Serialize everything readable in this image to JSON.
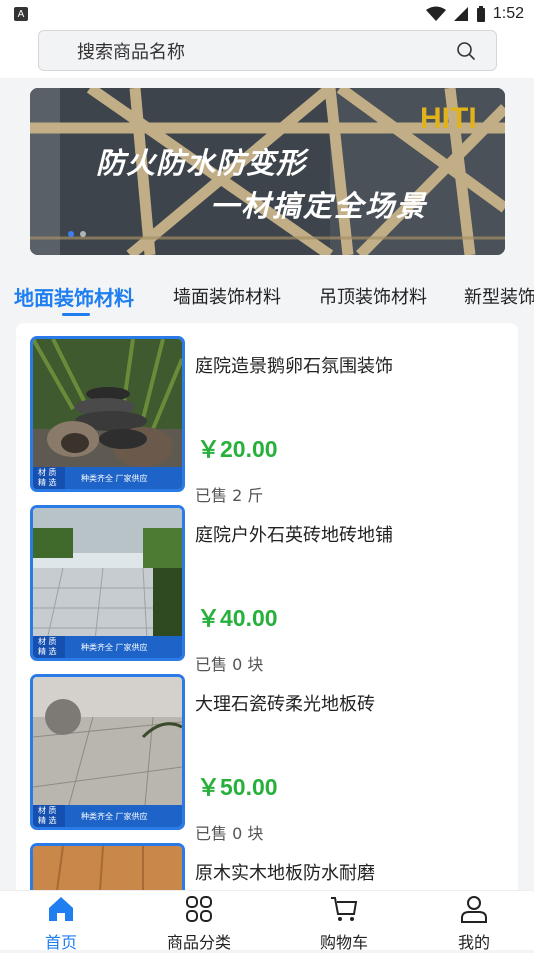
{
  "status": {
    "left_icon": "A",
    "time": "1:52"
  },
  "search": {
    "placeholder": "搜索商品名称"
  },
  "banner": {
    "line1": "防火防水防变形",
    "line2": "一材搞定全场景"
  },
  "tabs": [
    {
      "label": "地面装饰材料",
      "active": true
    },
    {
      "label": "墙面装饰材料",
      "active": false
    },
    {
      "label": "吊顶装饰材料",
      "active": false
    },
    {
      "label": "新型装饰",
      "active": false
    }
  ],
  "products": [
    {
      "title": "庭院造景鹅卵石氛围装饰",
      "price": "￥20.00",
      "sold": "已售 2 斤",
      "tag": "材 质\n精 选",
      "tag_sub": "种类齐全  厂家供应"
    },
    {
      "title": "庭院户外石英砖地砖地铺",
      "price": "￥40.00",
      "sold": "已售 0 块",
      "tag": "材 质\n精 选",
      "tag_sub": "种类齐全  厂家供应"
    },
    {
      "title": "大理石瓷砖柔光地板砖",
      "price": "￥50.00",
      "sold": "已售 0 块",
      "tag": "材 质\n精 选",
      "tag_sub": "种类齐全  厂家供应"
    },
    {
      "title": "原木实木地板防水耐磨",
      "price": "",
      "sold": "",
      "tag": "",
      "tag_sub": ""
    }
  ],
  "tabbar": [
    {
      "label": "首页",
      "icon": "home-icon",
      "active": true
    },
    {
      "label": "商品分类",
      "icon": "category-icon",
      "active": false
    },
    {
      "label": "购物车",
      "icon": "cart-icon",
      "active": false
    },
    {
      "label": "我的",
      "icon": "user-icon",
      "active": false
    }
  ],
  "colors": {
    "accent": "#1f7ef0",
    "price": "#28b03c"
  }
}
